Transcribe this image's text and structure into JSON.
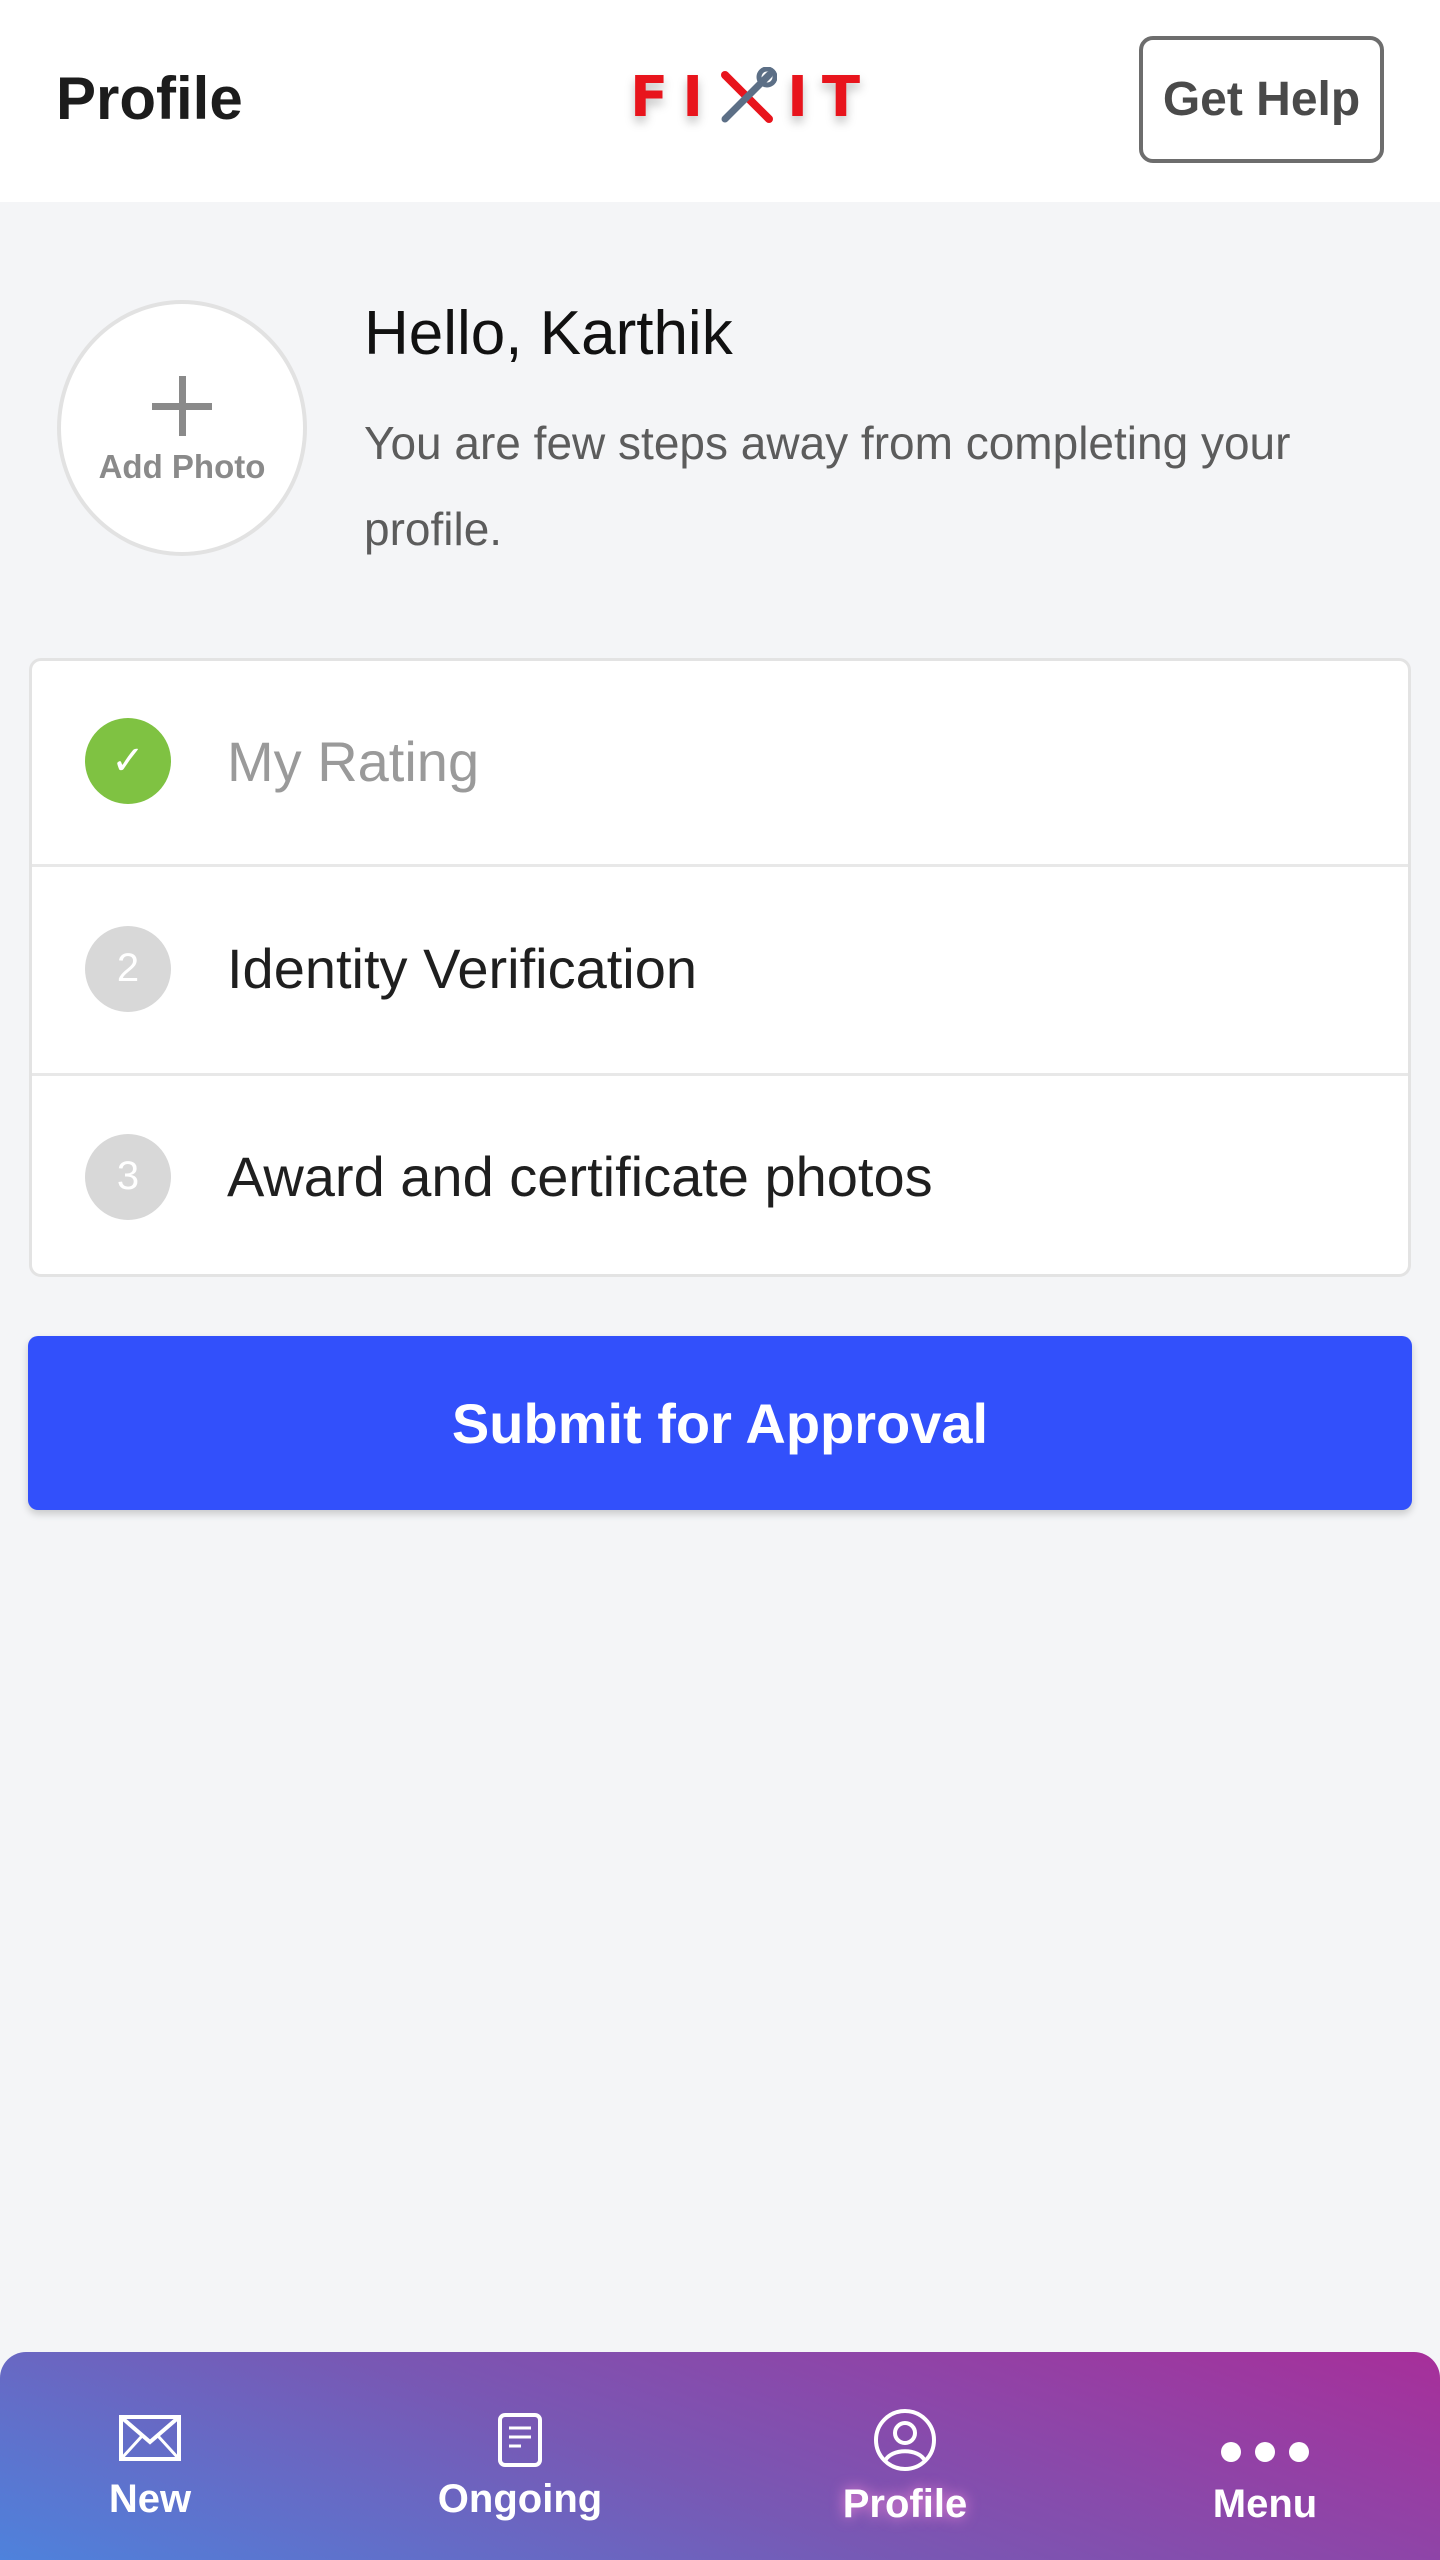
{
  "header": {
    "title": "Profile",
    "logo_text": "FIXIT",
    "help_label": "Get Help"
  },
  "profile": {
    "add_photo_label": "Add Photo",
    "greeting": "Hello, Karthik",
    "subtitle": "You are few steps away from completing your profile."
  },
  "steps": [
    {
      "badge": "✓",
      "label": "My Rating",
      "status": "completed"
    },
    {
      "badge": "2",
      "label": "Identity Verification",
      "status": "pending"
    },
    {
      "badge": "3",
      "label": "Award and certificate photos",
      "status": "pending"
    }
  ],
  "submit_label": "Submit for Approval",
  "bottom_nav": [
    {
      "label": "New",
      "icon": "envelope-icon"
    },
    {
      "label": "Ongoing",
      "icon": "document-icon"
    },
    {
      "label": "Profile",
      "icon": "user-circle-icon",
      "active": true
    },
    {
      "label": "Menu",
      "icon": "more-dots-icon"
    }
  ],
  "colors": {
    "accent": "#3250fb",
    "completed": "#7fc242",
    "logo_red": "#e8141c",
    "nav_gradient_start": "#4e82dc",
    "nav_gradient_end": "#a72f9a"
  }
}
